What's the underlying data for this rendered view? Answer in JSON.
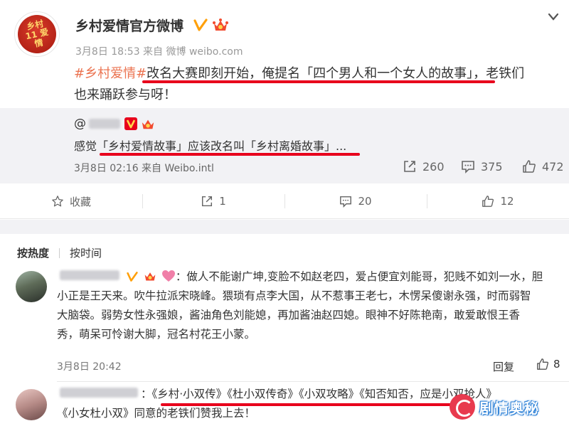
{
  "post": {
    "avatar_text": "乡村11 爱情",
    "user_name": "乡村爱情官方微博",
    "meta": "3月8日 18:53 来自 微博 weibo.com",
    "topic": "#乡村爱情#",
    "text_line1": "改名大赛即刻开始，俺提名「四个男人和一个女人的故事」，老铁们",
    "text_line2": "也来踊跃参与呀！"
  },
  "repost": {
    "mention_prefix": "@",
    "text": "感觉「乡村爱情故事」应该改名叫「乡村离婚故事」...",
    "meta": "3月8日 02:16 来自 Weibo.intl",
    "reposts": "260",
    "comments": "375",
    "likes": "472"
  },
  "actions": {
    "favorite": "收藏",
    "repost": "1",
    "comment": "20",
    "like": "12"
  },
  "comments_section": {
    "sort_hot": "按热度",
    "sort_time": "按时间",
    "comment1": {
      "line1": "：做人不能谢广坤,变脸不如赵老四，爱占便宜刘能哥，犯贱不如刘一水，胆",
      "line2": "小正是王天来。吹牛拉派宋晓峰。猥琐有点李大国，从不惹事王老七，木愣呆傻谢永强，时而弱智",
      "line3": "大脑袋。弱势女性永强娘，酱油角色刘能媳，再加酱油赵四媳。眼神不好陈艳南，敢爱敢恨王香",
      "line4": "秀，萌呆可怜谢大脚，冠名村花王小蒙。",
      "meta": "3月8日 20:42",
      "reply": "回复",
      "likes": "8"
    },
    "comment2": {
      "line1": "：《乡村·小双传》《杜小双传奇》《小双攻略》《知否知否，应是小双抢人》",
      "line2": "《小女杜小双》同意的老铁们赞我上去！"
    }
  },
  "watermark": {
    "text": "剧情奥秘"
  },
  "colors": {
    "topic": "#eb7350",
    "underline": "#e8001c",
    "verified": "#ffa00a",
    "repost_bg": "#f2f2f5"
  }
}
